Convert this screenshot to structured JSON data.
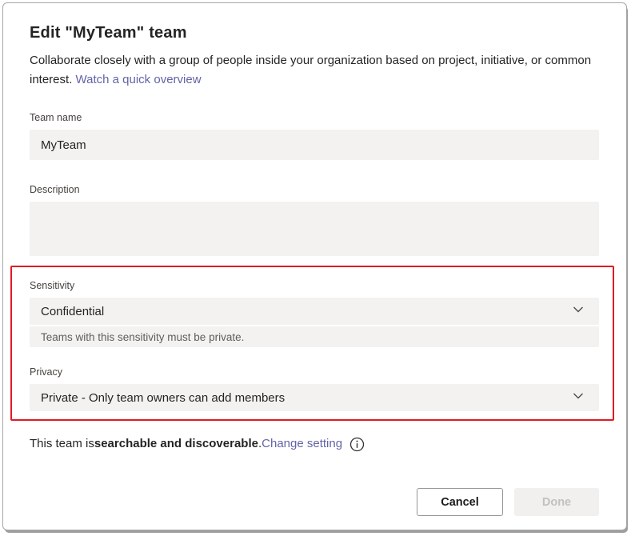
{
  "dialog": {
    "title": "Edit \"MyTeam\" team",
    "subtitle": "Collaborate closely with a group of people inside your organization based on project, initiative, or common interest. ",
    "subtitle_link": "Watch a quick overview"
  },
  "fields": {
    "team_name": {
      "label": "Team name",
      "value": "MyTeam"
    },
    "description": {
      "label": "Description",
      "value": ""
    },
    "sensitivity": {
      "label": "Sensitivity",
      "value": "Confidential",
      "helper": "Teams with this sensitivity must be private."
    },
    "privacy": {
      "label": "Privacy",
      "value": "Private - Only team owners can add members"
    }
  },
  "footer": {
    "text_prefix": "This team is ",
    "text_bold": "searchable and discoverable",
    "text_suffix": ". ",
    "link": "Change setting"
  },
  "buttons": {
    "cancel": "Cancel",
    "done": "Done"
  },
  "colors": {
    "accent_link": "#6264a7",
    "highlight_red": "#e01b24",
    "field_bg": "#f3f2f1",
    "helper_text": "#605e5c"
  }
}
